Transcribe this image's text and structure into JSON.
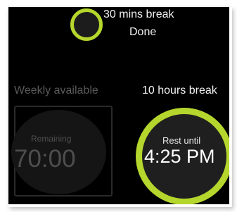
{
  "top_card": {
    "title": "30 mins break",
    "status": "Done"
  },
  "left_card": {
    "title": "Weekly available",
    "label": "Remaining",
    "value": "70:00"
  },
  "right_card": {
    "title": "10 hours break",
    "label": "Rest until",
    "value": "4:25 PM"
  },
  "colors": {
    "accent": "#b5d62c",
    "background": "#000000",
    "text": "#f2f2f2",
    "dim_text": "#4e4e4e"
  }
}
